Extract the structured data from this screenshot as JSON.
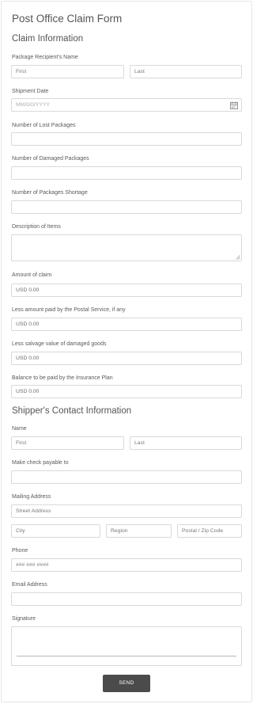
{
  "form": {
    "title": "Post Office Claim Form",
    "claim_section_title": "Claim Information",
    "recipient_label": "Package Recipient's Name",
    "recipient_first_placeholder": "First",
    "recipient_last_placeholder": "Last",
    "shipment_date_label": "Shipment Date",
    "shipment_date_placeholder": "MM/DD/YYYY",
    "lost_label": "Number of Lost Packages",
    "damaged_label": "Number of Damaged Packages",
    "shortage_label": "Number of Packages Shortage",
    "description_label": "Description of Items",
    "amount_label": "Amount of claim",
    "amount_value": "USD  0.00",
    "postal_paid_label": "Less amount paid by the Postal Service, if any",
    "postal_paid_value": "USD  0.00",
    "salvage_label": "Less salvage value of damaged goods",
    "salvage_value": "USD  0.00",
    "balance_label": "Balance to be paid by the Insurance Plan",
    "balance_value": "USD  0.00",
    "shipper_section_title": "Shipper's Contact Information",
    "name_label": "Name",
    "name_first_placeholder": "First",
    "name_last_placeholder": "Last",
    "payable_label": "Make check payable to",
    "mailing_label": "Mailing Address",
    "street_placeholder": "Street Address",
    "city_placeholder": "City",
    "region_placeholder": "Region",
    "zip_placeholder": "Postal / Zip Code",
    "phone_label": "Phone",
    "phone_placeholder": "### ### ####",
    "email_label": "Email Address",
    "signature_label": "Signature",
    "send_label": "SEND"
  },
  "icons": {
    "date": "calendar-icon",
    "textarea": "resize-handle-icon"
  },
  "colors": {
    "button_bg": "#4b4b4b",
    "border": "#d9d9d9"
  }
}
